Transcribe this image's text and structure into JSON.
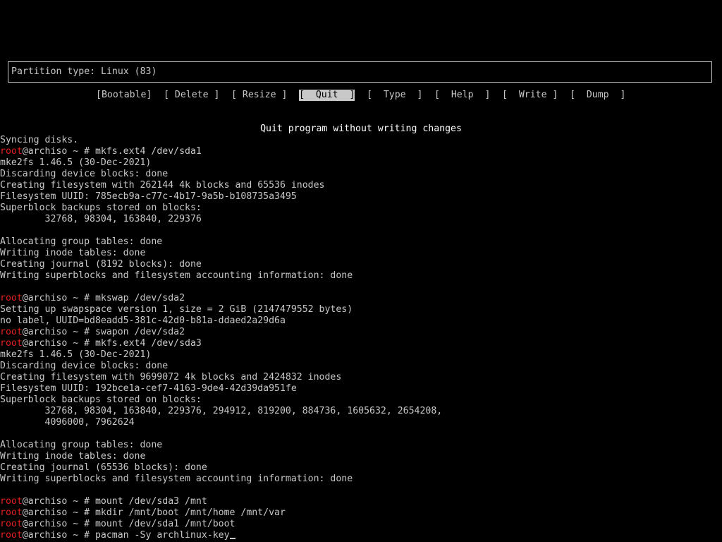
{
  "cfdisk": {
    "partition_type": "Partition type: Linux (83)",
    "menu": [
      {
        "label": "[Bootable]",
        "selected": false
      },
      {
        "label": "[ Delete ]",
        "selected": false
      },
      {
        "label": "[ Resize ]",
        "selected": false
      },
      {
        "label": "[  Quit  ]",
        "selected": true
      },
      {
        "label": "[  Type  ]",
        "selected": false
      },
      {
        "label": "[  Help  ]",
        "selected": false
      },
      {
        "label": "[  Write ]",
        "selected": false
      },
      {
        "label": "[  Dump  ]",
        "selected": false
      }
    ],
    "hint": "Quit program without writing changes"
  },
  "terminal": {
    "prompt_user": "root",
    "prompt_rest": "@archiso ~ # ",
    "lines": [
      {
        "type": "out",
        "text": "Syncing disks."
      },
      {
        "type": "cmd",
        "text": "mkfs.ext4 /dev/sda1"
      },
      {
        "type": "out",
        "text": "mke2fs 1.46.5 (30-Dec-2021)"
      },
      {
        "type": "out",
        "text": "Discarding device blocks: done"
      },
      {
        "type": "out",
        "text": "Creating filesystem with 262144 4k blocks and 65536 inodes"
      },
      {
        "type": "out",
        "text": "Filesystem UUID: 785ecb9a-c77c-4b17-9a5b-b108735a3495"
      },
      {
        "type": "out",
        "text": "Superblock backups stored on blocks:"
      },
      {
        "type": "out",
        "text": "        32768, 98304, 163840, 229376"
      },
      {
        "type": "out",
        "text": ""
      },
      {
        "type": "out",
        "text": "Allocating group tables: done"
      },
      {
        "type": "out",
        "text": "Writing inode tables: done"
      },
      {
        "type": "out",
        "text": "Creating journal (8192 blocks): done"
      },
      {
        "type": "out",
        "text": "Writing superblocks and filesystem accounting information: done"
      },
      {
        "type": "out",
        "text": ""
      },
      {
        "type": "cmd",
        "text": "mkswap /dev/sda2"
      },
      {
        "type": "out",
        "text": "Setting up swapspace version 1, size = 2 GiB (2147479552 bytes)"
      },
      {
        "type": "out",
        "text": "no label, UUID=bd8eadd5-381c-42d0-b81a-ddaed2a29d6a"
      },
      {
        "type": "cmd",
        "text": "swapon /dev/sda2"
      },
      {
        "type": "cmd",
        "text": "mkfs.ext4 /dev/sda3"
      },
      {
        "type": "out",
        "text": "mke2fs 1.46.5 (30-Dec-2021)"
      },
      {
        "type": "out",
        "text": "Discarding device blocks: done"
      },
      {
        "type": "out",
        "text": "Creating filesystem with 9699072 4k blocks and 2424832 inodes"
      },
      {
        "type": "out",
        "text": "Filesystem UUID: 192bce1a-cef7-4163-9de4-42d39da951fe"
      },
      {
        "type": "out",
        "text": "Superblock backups stored on blocks:"
      },
      {
        "type": "out",
        "text": "        32768, 98304, 163840, 229376, 294912, 819200, 884736, 1605632, 2654208,"
      },
      {
        "type": "out",
        "text": "        4096000, 7962624"
      },
      {
        "type": "out",
        "text": ""
      },
      {
        "type": "out",
        "text": "Allocating group tables: done"
      },
      {
        "type": "out",
        "text": "Writing inode tables: done"
      },
      {
        "type": "out",
        "text": "Creating journal (65536 blocks): done"
      },
      {
        "type": "out",
        "text": "Writing superblocks and filesystem accounting information: done"
      },
      {
        "type": "out",
        "text": ""
      },
      {
        "type": "cmd",
        "text": "mount /dev/sda3 /mnt"
      },
      {
        "type": "cmd",
        "text": "mkdir /mnt/boot /mnt/home /mnt/var"
      },
      {
        "type": "cmd",
        "text": "mount /dev/sda1 /mnt/boot"
      },
      {
        "type": "cmd",
        "text": "pacman -Sy archlinux-key",
        "cursor": true
      }
    ]
  },
  "colors": {
    "background": "#000000",
    "foreground": "#c8c8c8",
    "prompt_user": "#e02020",
    "selected_bg": "#c8c8c8"
  }
}
